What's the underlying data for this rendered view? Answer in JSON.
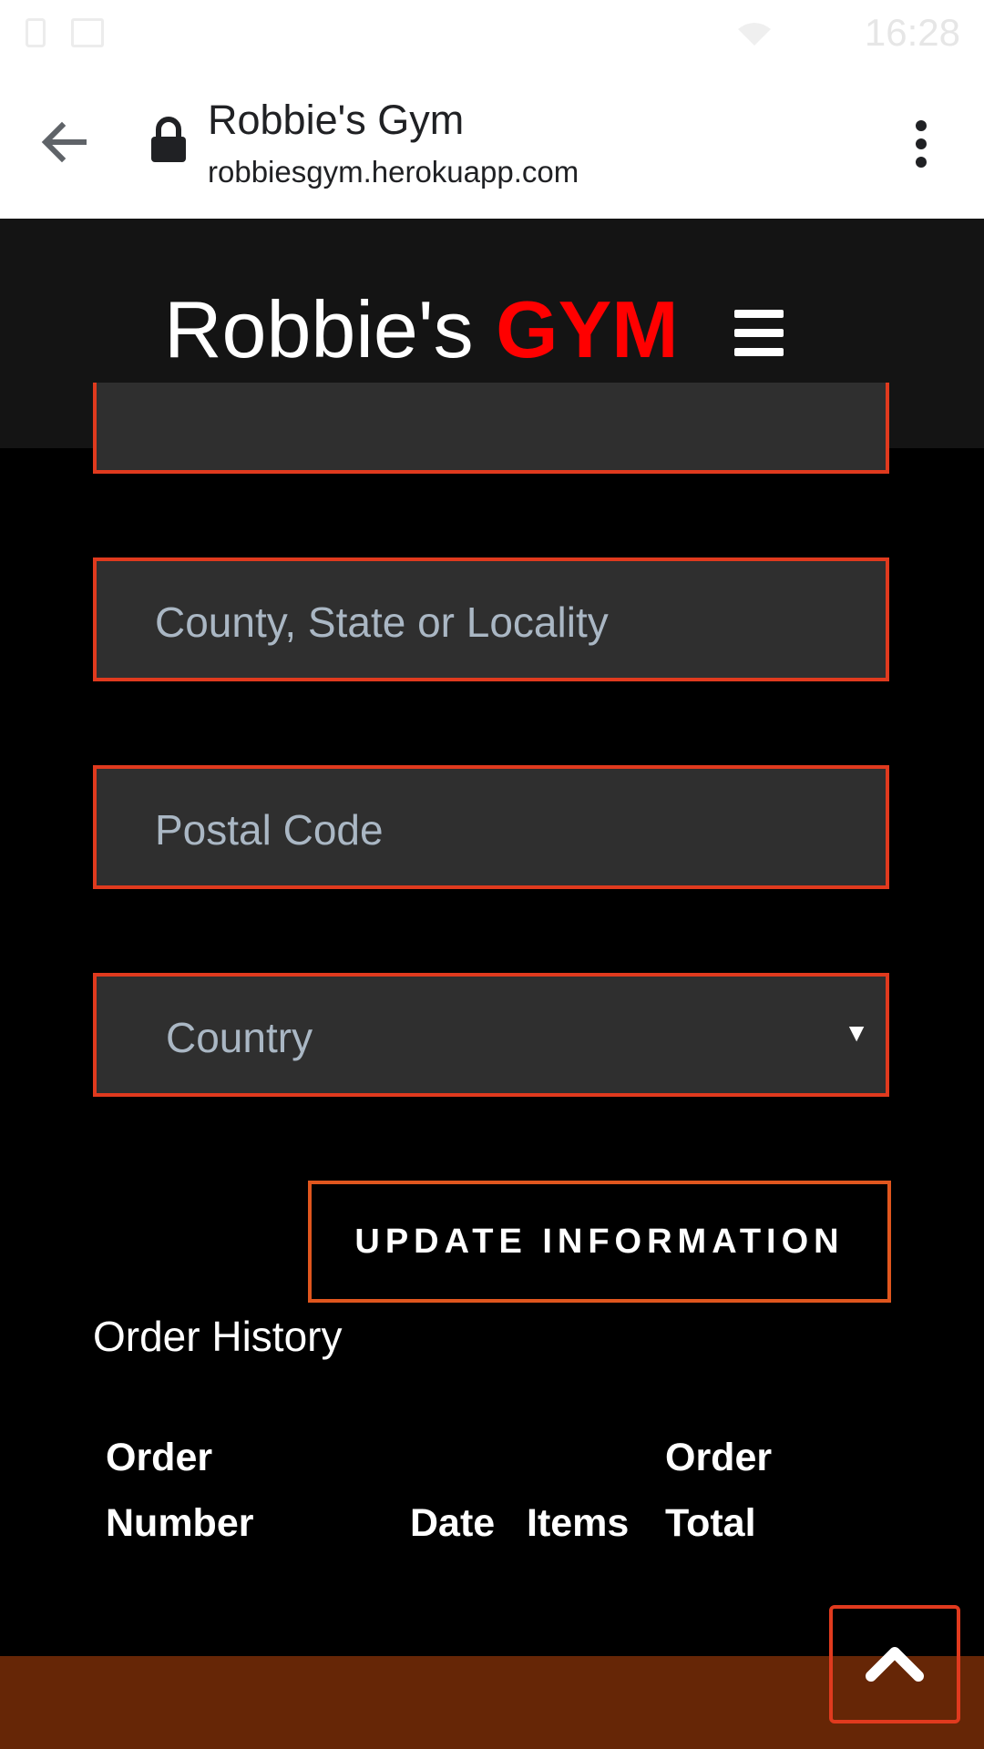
{
  "status_bar": {
    "time": "16:28",
    "icons": [
      "sim-icon",
      "image-icon",
      "wifi-icon"
    ]
  },
  "browser": {
    "title": "Robbie's Gym",
    "url": "robbiesgym.herokuapp.com",
    "icons": [
      "back-arrow-icon",
      "lock-icon",
      "more-vert-icon"
    ]
  },
  "header": {
    "brand_main": "Robbie's ",
    "brand_accent": "GYM",
    "menu_icon": "hamburger-menu-icon"
  },
  "form": {
    "county_placeholder": "County, State or Locality",
    "postal_placeholder": "Postal Code",
    "country_selected": "Country",
    "update_label": "UPDATE INFORMATION"
  },
  "order_history": {
    "heading": "Order History",
    "columns": [
      "Order\nNumber",
      "Date",
      "Items",
      "Order\nTotal"
    ],
    "col1_line1": "Order",
    "col1_line2": "Number",
    "col2": "Date",
    "col3": "Items",
    "col4_line1": "Order",
    "col4_line2": "Total"
  },
  "colors": {
    "accent_red": "#ff0000",
    "field_border": "#e03a1e",
    "footer": "#662606",
    "header_bg": "#141414"
  },
  "scroll_top_icon": "chevron-up-icon"
}
